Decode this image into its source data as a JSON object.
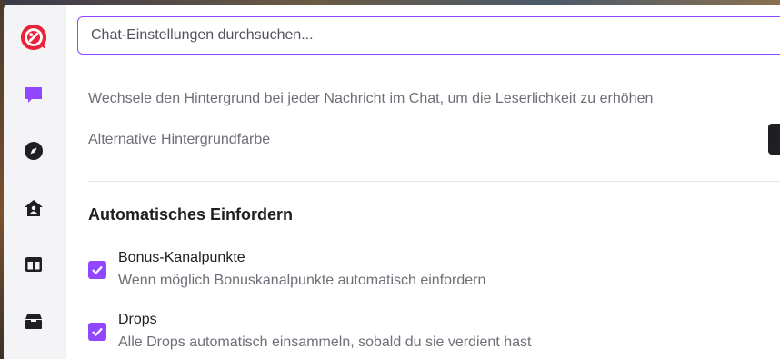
{
  "search": {
    "placeholder": "Chat-Einstellungen durchsuchen..."
  },
  "sidebar": {
    "items": [
      {
        "icon": "app-logo-icon"
      },
      {
        "icon": "chat-bubble-icon",
        "color": "#9147ff"
      },
      {
        "icon": "compass-icon"
      },
      {
        "icon": "home-icon"
      },
      {
        "icon": "layout-columns-icon"
      },
      {
        "icon": "gift-box-icon"
      }
    ]
  },
  "settings": {
    "alternate_background_description": "Wechsele den Hintergrund bei jeder Nachricht im Chat, um die Leserlichkeit zu erhöhen",
    "alternate_background_color_label": "Alternative Hintergrundfarbe",
    "alternate_background_color": "#1f1f23"
  },
  "auto_claim": {
    "title": "Automatisches Einfordern",
    "options": [
      {
        "label": "Bonus-Kanalpunkte",
        "description": "Wenn möglich Bonuskanalpunkte automatisch einfordern",
        "checked": true
      },
      {
        "label": "Drops",
        "description": "Alle Drops automatisch einsammeln, sobald du sie verdient hast",
        "checked": true
      }
    ]
  },
  "colors": {
    "accent": "#9147ff",
    "logo": "#e8233a"
  }
}
